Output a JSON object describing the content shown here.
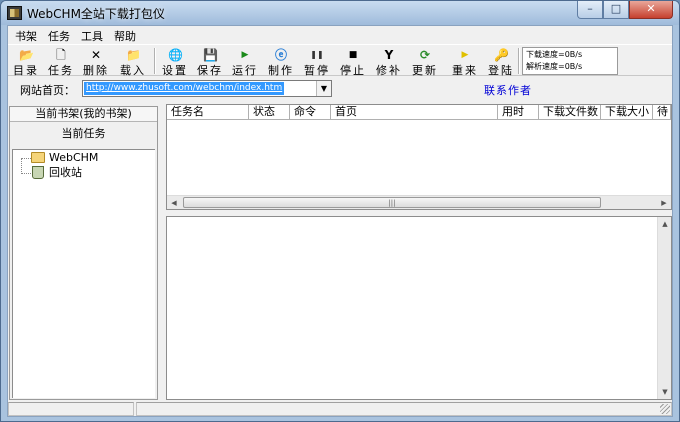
{
  "window": {
    "title": "WebCHM全站下载打包仪",
    "controls": {
      "minimize": "–",
      "maximize": "□",
      "close": "✕"
    }
  },
  "menu": [
    "书架",
    "任务",
    "工具",
    "帮助"
  ],
  "toolbar": {
    "buttons": [
      {
        "label": "目录",
        "icon": "folder-open-icon",
        "glyph": "📂"
      },
      {
        "label": "任务",
        "icon": "document-icon",
        "glyph": "🗋"
      },
      {
        "label": "删除",
        "icon": "delete-icon",
        "glyph": "✕"
      },
      {
        "label": "载入",
        "icon": "load-folder-icon",
        "glyph": "📁"
      },
      {
        "label": "设置",
        "icon": "globe-icon",
        "glyph": "🌐"
      },
      {
        "label": "保存",
        "icon": "save-icon",
        "glyph": "💾"
      },
      {
        "label": "运行",
        "icon": "play-icon",
        "glyph": "▶"
      },
      {
        "label": "制作",
        "icon": "ie-icon",
        "glyph": "ⓔ"
      },
      {
        "label": "暂停",
        "icon": "pause-icon",
        "glyph": "❚❚"
      },
      {
        "label": "停止",
        "icon": "stop-icon",
        "glyph": "■"
      },
      {
        "label": "修补",
        "icon": "wrench-icon",
        "glyph": "Y"
      },
      {
        "label": "更新",
        "icon": "refresh-icon",
        "glyph": "⟳"
      },
      {
        "label": "重来",
        "icon": "restart-icon",
        "glyph": "▶"
      },
      {
        "label": "登陆",
        "icon": "login-icon",
        "glyph": "🔑"
      }
    ],
    "speed": {
      "download": "下载速度=0B/s",
      "parse": "解析速度=0B/s"
    }
  },
  "address": {
    "label": "网站首页：",
    "url": "http://www.zhusoft.com/webchm/index.htm",
    "contact": "联系作者"
  },
  "left_pane": {
    "header": "当前书架(我的书架)",
    "subheader": "当前任务",
    "tree": [
      "WebCHM",
      "回收站"
    ]
  },
  "task_table": {
    "columns": [
      "任务名",
      "状态",
      "命令",
      "首页",
      "用时",
      "下载文件数",
      "下载大小",
      "待"
    ]
  },
  "colors": {
    "url_highlight": "#3399ff",
    "contact_link": "#0000d6",
    "close_button": "#c6402e"
  }
}
